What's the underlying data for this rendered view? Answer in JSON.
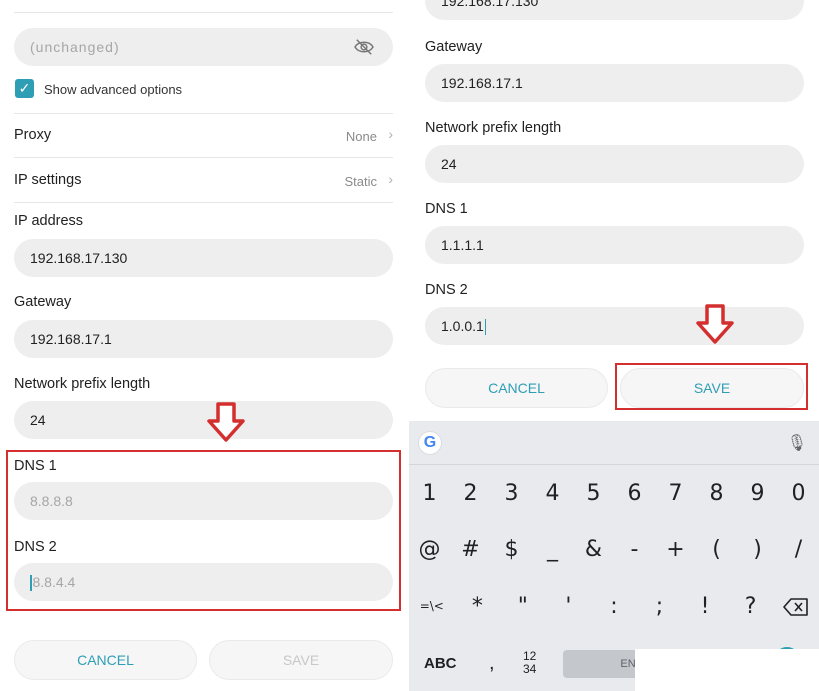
{
  "left": {
    "password_placeholder": "(unchanged)",
    "show_advanced_label": "Show advanced options",
    "proxy": {
      "label": "Proxy",
      "value": "None"
    },
    "ip_settings": {
      "label": "IP settings",
      "value": "Static"
    },
    "ip_address": {
      "label": "IP address",
      "value": "192.168.17.130"
    },
    "gateway": {
      "label": "Gateway",
      "value": "192.168.17.1"
    },
    "prefix": {
      "label": "Network prefix length",
      "value": "24"
    },
    "dns1": {
      "label": "DNS 1",
      "placeholder": "8.8.8.8"
    },
    "dns2": {
      "label": "DNS 2",
      "placeholder": "8.8.4.4"
    },
    "cancel_label": "CANCEL",
    "save_label": "SAVE"
  },
  "right": {
    "top_value": "192.168.17.130",
    "gateway": {
      "label": "Gateway",
      "value": "192.168.17.1"
    },
    "prefix": {
      "label": "Network prefix length",
      "value": "24"
    },
    "dns1": {
      "label": "DNS 1",
      "value": "1.1.1.1"
    },
    "dns2": {
      "label": "DNS 2",
      "value": "1.0.0.1"
    },
    "cancel_label": "CANCEL",
    "save_label": "SAVE"
  },
  "keyboard": {
    "row1": [
      "1",
      "2",
      "3",
      "4",
      "5",
      "6",
      "7",
      "8",
      "9",
      "0"
    ],
    "row2": [
      "@",
      "#",
      "$",
      "_",
      "&",
      "-",
      "+",
      "(",
      ")",
      "/"
    ],
    "row3": [
      "=\\<",
      "*",
      "\"",
      "'",
      ":",
      ";",
      "!",
      "?"
    ],
    "abc_label": "ABC",
    "comma": ",",
    "frac_top": "12",
    "frac_bottom": "34",
    "lang_label": "EN"
  },
  "colors": {
    "accent": "#2e9eb5",
    "highlight": "#d32f2f"
  }
}
